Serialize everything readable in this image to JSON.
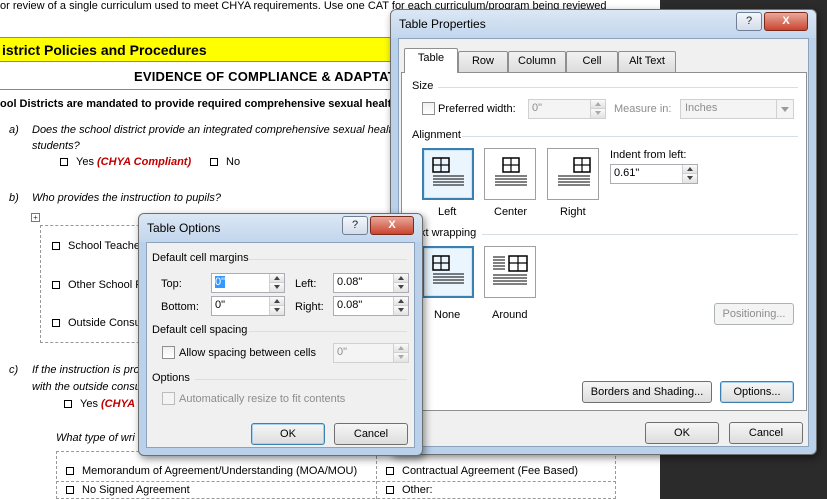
{
  "document": {
    "intro": "or review of a single curriculum used to meet CHYA requirements.  Use one CAT for each curriculum/program being reviewed",
    "section_title": "istrict Policies and Procedures",
    "heading": "EVIDENCE OF COMPLIANCE & ADAPTATIO",
    "mandate": "ool Districts are mandated to provide required comprehensive sexual health a",
    "q_a_letter": "a)",
    "q_a_text": "Does the school district provide an integrated comprehensive sexual healt",
    "q_a_text2": "students?",
    "yes_label": "Yes",
    "chya_compliant": "(CHYA Compliant)",
    "no_label": "No",
    "q_b_letter": "b)",
    "q_b_text": "Who provides the instruction to pupils?",
    "opt_school_teacher": "School Teache",
    "opt_other_school": "Other School P",
    "opt_outside": "Outside Consul",
    "q_c_letter": "c)",
    "q_c_text": "If the instruction is pro",
    "q_c_text2": "with the outside consu",
    "yes2_label": "Yes",
    "chya2": "(CHYA (",
    "what_type": "What type of wri",
    "moa": "Memorandum of Agreement/Understanding (MOA/MOU)",
    "contractual": "Contractual Agreement (Fee Based)",
    "no_signed": "No Signed Agreement",
    "other": "Other:"
  },
  "table_properties": {
    "title": "Table Properties",
    "help": "?",
    "close": "X",
    "tabs": [
      "Table",
      "Row",
      "Column",
      "Cell",
      "Alt Text"
    ],
    "size_label": "Size",
    "preferred_width_label": "Preferred width:",
    "preferred_width_value": "0\"",
    "measure_in_label": "Measure in:",
    "measure_in_value": "Inches",
    "alignment_label": "Alignment",
    "align_options": [
      "Left",
      "Center",
      "Right"
    ],
    "indent_label": "Indent from left:",
    "indent_value": "0.61\"",
    "wrapping_label": "xt wrapping",
    "wrap_options": [
      "None",
      "Around"
    ],
    "positioning_button": "Positioning...",
    "borders_button": "Borders and Shading...",
    "options_button": "Options...",
    "ok_button": "OK",
    "cancel_button": "Cancel"
  },
  "table_options": {
    "title": "Table Options",
    "help": "?",
    "close": "X",
    "margins_label": "Default cell margins",
    "top_label": "Top:",
    "top_value": "0\"",
    "left_label": "Left:",
    "left_value": "0.08\"",
    "bottom_label": "Bottom:",
    "bottom_value": "0\"",
    "right_label": "Right:",
    "right_value": "0.08\"",
    "spacing_label": "Default cell spacing",
    "allow_spacing_label": "Allow spacing between cells",
    "spacing_value": "0\"",
    "options_label": "Options",
    "auto_resize_label": "Automatically resize to fit contents",
    "ok_button": "OK",
    "cancel_button": "Cancel"
  },
  "colors": {
    "highlight_yellow": "#ffff00",
    "compliant_red": "#c00000",
    "selected_blue": "#3c7fb1"
  }
}
